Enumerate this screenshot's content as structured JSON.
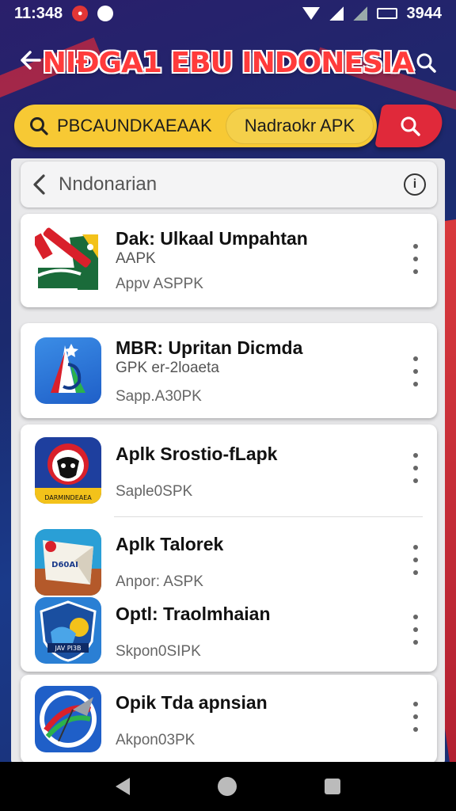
{
  "status_bar": {
    "time": "11:348",
    "battery": "3944"
  },
  "header": {
    "title": "NIĐGA1 EBU INDONESIA"
  },
  "search": {
    "left_text": "PBCAUNDKAEAAK",
    "right_text": "Nadraokr APK"
  },
  "sub_header": {
    "title": "Nndonarian"
  },
  "apps": [
    {
      "name": "Dak: Ulkaal Umpahtan",
      "sub1": "AAPK",
      "sub2": "Appv ASPPK",
      "icon": "red-rifle-flag-icon"
    },
    {
      "name": "MBR: Upritan Dicmda",
      "sub1": "GPK  er-2loaeta",
      "sub2": "Sapp.A30PK",
      "icon": "blue-garuda-icon"
    },
    {
      "name": "Aplk Srostio-fLapk",
      "sub1": "",
      "sub2": "Saple0SPK",
      "icon": "mask-emblem-icon"
    },
    {
      "name": "Aplk Talorek",
      "sub1": "",
      "sub2": "Anpor: ASPK",
      "icon": "document-fold-icon"
    },
    {
      "name": "Optl: Traolmhaian",
      "sub1": "",
      "sub2": "Skpon0SIPK",
      "icon": "shield-badge-icon"
    },
    {
      "name": "Opik Tda apnsian",
      "sub1": "",
      "sub2": "Akpon03PK",
      "icon": "quill-emblem-icon"
    }
  ],
  "colors": {
    "accent_yellow": "#f7c934",
    "accent_red": "#e0293a",
    "bg_blue": "#1d2357"
  }
}
